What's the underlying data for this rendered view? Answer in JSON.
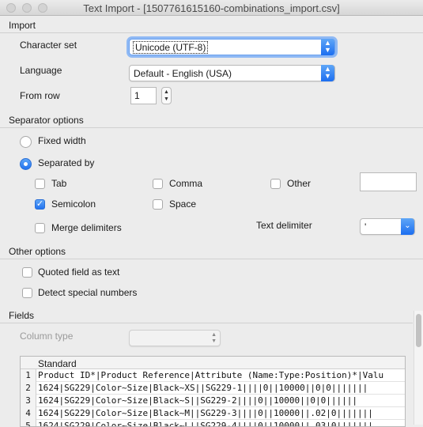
{
  "window": {
    "title": "Text Import - [1507761615160-combinations_import.csv]"
  },
  "import_section": {
    "label": "Import",
    "character_set_label": "Character set",
    "character_set_value": "Unicode (UTF-8)",
    "language_label": "Language",
    "language_value": "Default - English (USA)",
    "from_row_label": "From row",
    "from_row_value": "1"
  },
  "separator_section": {
    "label": "Separator options",
    "fixed_width_label": "Fixed width",
    "separated_by_label": "Separated by",
    "selected_mode": "separated_by",
    "tab_label": "Tab",
    "comma_label": "Comma",
    "other_label": "Other",
    "other_value": "",
    "semicolon_label": "Semicolon",
    "space_label": "Space",
    "merge_delimiters_label": "Merge delimiters",
    "text_delimiter_label": "Text delimiter",
    "text_delimiter_value": "'",
    "checked": {
      "tab": false,
      "comma": false,
      "other": false,
      "semicolon": true,
      "space": false,
      "merge": false
    }
  },
  "other_options_section": {
    "label": "Other options",
    "quoted_field_label": "Quoted field as text",
    "detect_special_label": "Detect special numbers"
  },
  "fields_section": {
    "label": "Fields",
    "column_type_label": "Column type",
    "column_type_value": "",
    "header": "Standard",
    "rows": [
      {
        "num": "1",
        "text": "Product ID*|Product Reference|Attribute (Name:Type:Position)*|Valu"
      },
      {
        "num": "2",
        "text": "1624|SG229|Color~Size|Black~XS||SG229-1||||0||10000||0|0|||||||"
      },
      {
        "num": "3",
        "text": "1624|SG229|Color~Size|Black~S||SG229-2||||0||10000||0|0||||||"
      },
      {
        "num": "4",
        "text": "1624|SG229|Color~Size|Black~M||SG229-3||||0||10000||.02|0|||||||"
      },
      {
        "num": "5",
        "text": "1624|SG229|Color~Size|Black~L||SG229-4||||0||10000||.03|0|||||||"
      }
    ]
  },
  "colors": {
    "accent": "#2373ef",
    "background": "#ececec"
  }
}
